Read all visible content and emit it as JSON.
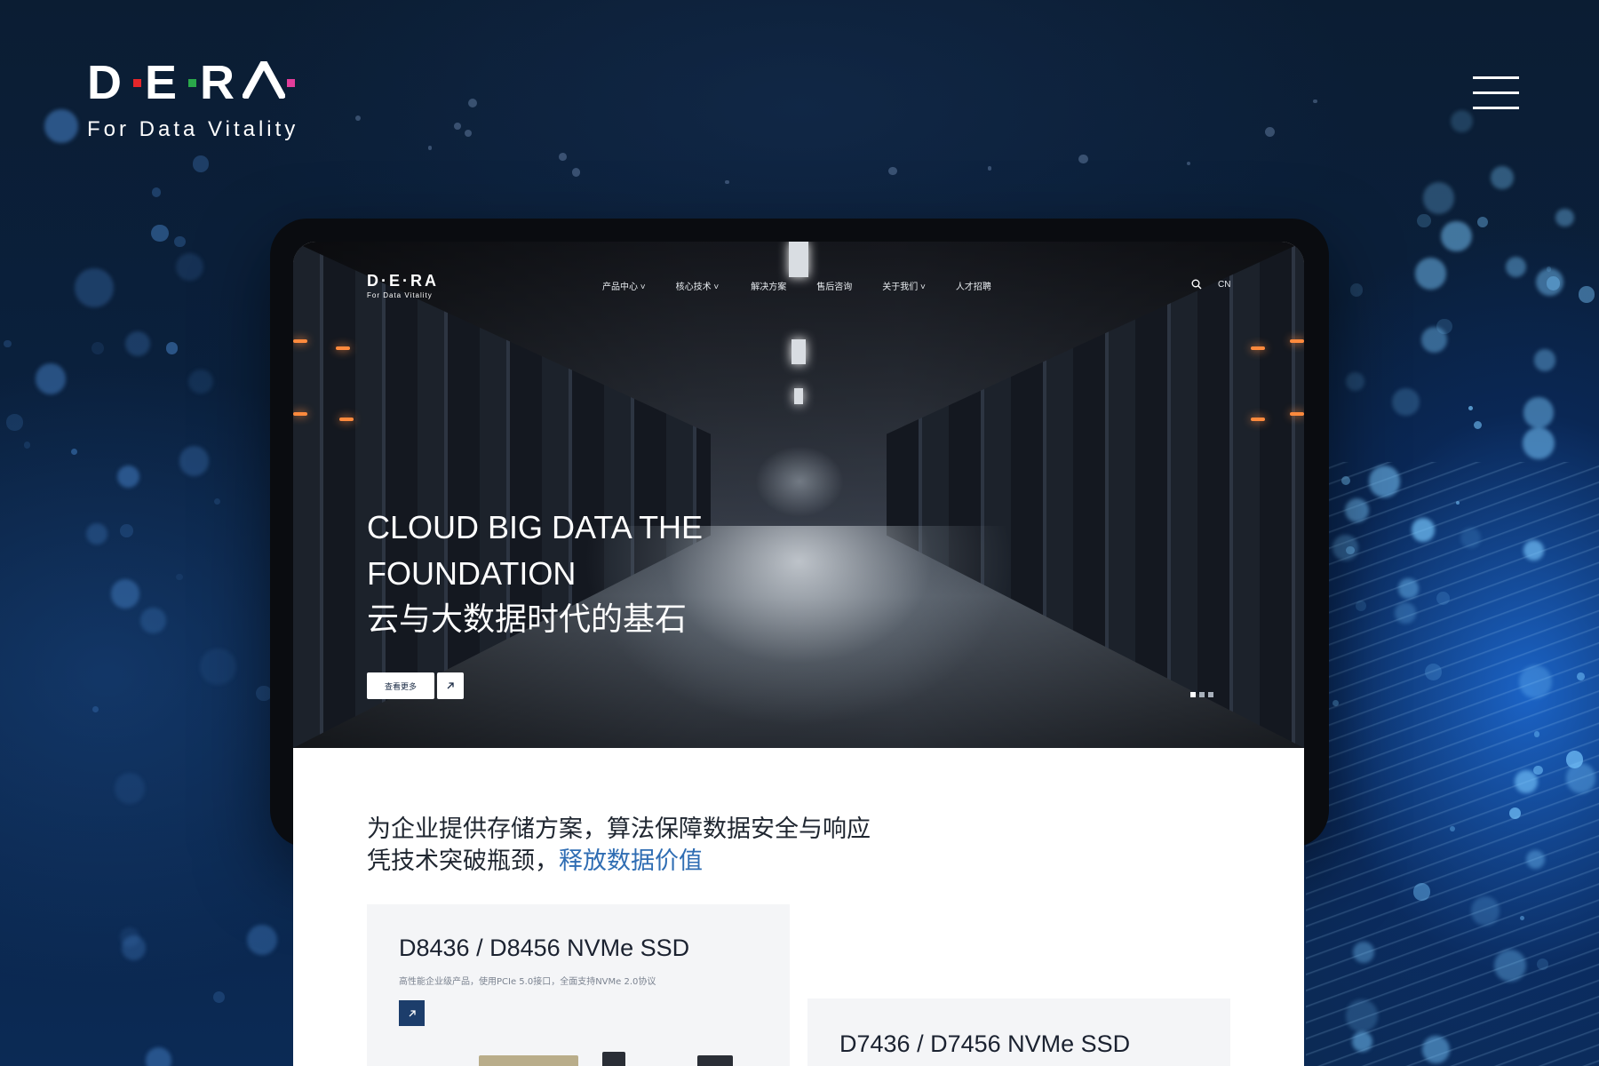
{
  "brand": {
    "logo_text": "D·E·RA",
    "tagline": "For Data Vitality",
    "dot_colors": [
      "#e5262a",
      "#2aa84a",
      "#e23d9a",
      "#e5262a"
    ]
  },
  "menu": {
    "icon": "hamburger-menu-icon"
  },
  "inner_site": {
    "logo_text": "D·E·RA",
    "logo_tagline": "For Data Vitality",
    "nav": [
      {
        "label": "产品中心",
        "has_dropdown": true
      },
      {
        "label": "核心技术",
        "has_dropdown": true
      },
      {
        "label": "解决方案",
        "has_dropdown": false
      },
      {
        "label": "售后咨询",
        "has_dropdown": false
      },
      {
        "label": "关于我们",
        "has_dropdown": true
      },
      {
        "label": "人才招聘",
        "has_dropdown": false
      }
    ],
    "search_icon": "search-icon",
    "language": "CN",
    "hero": {
      "title_en_line1": "CLOUD BIG DATA THE",
      "title_en_line2": "FOUNDATION",
      "title_cn": "云与大数据时代的基石",
      "cta_label": "查看更多",
      "cta_icon": "arrow-up-right-icon",
      "slide_count": 3,
      "active_slide": 1
    },
    "intro": {
      "line1": "为企业提供存储方案，算法保障数据安全与响应",
      "line2_prefix": "凭技术突破瓶颈，",
      "line2_highlight": "释放数据价值",
      "highlight_color": "#2f6db3"
    },
    "products": [
      {
        "title": "D8436 / D8456 NVMe SSD",
        "subtitle": "高性能企业级产品，使用PCIe 5.0接口，全面支持NVMe 2.0协议",
        "icon": "arrow-up-right-icon"
      },
      {
        "title": "D7436 / D7456 NVMe SSD"
      }
    ]
  },
  "colors": {
    "accent_dark_blue": "#1c3d6b",
    "background": "#081a30"
  }
}
